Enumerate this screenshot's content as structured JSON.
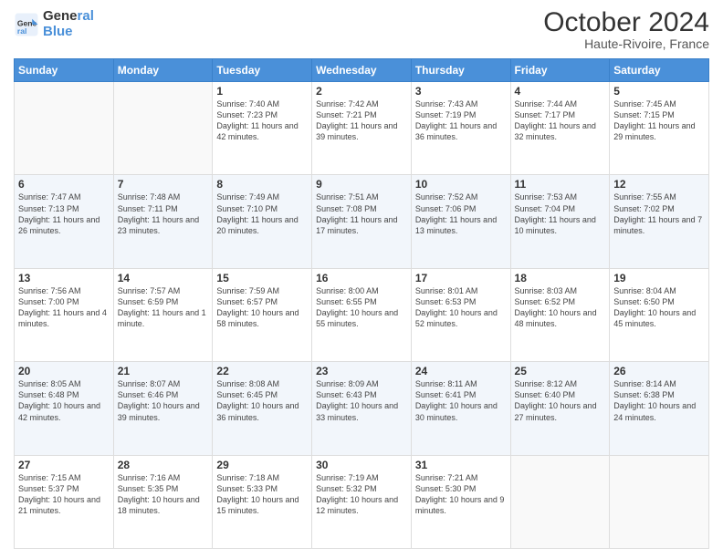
{
  "header": {
    "logo_line1": "General",
    "logo_line2": "Blue",
    "title": "October 2024",
    "subtitle": "Haute-Rivoire, France"
  },
  "weekdays": [
    "Sunday",
    "Monday",
    "Tuesday",
    "Wednesday",
    "Thursday",
    "Friday",
    "Saturday"
  ],
  "weeks": [
    [
      {
        "day": null
      },
      {
        "day": null
      },
      {
        "day": "1",
        "sunrise": "7:40 AM",
        "sunset": "7:23 PM",
        "daylight": "11 hours and 42 minutes."
      },
      {
        "day": "2",
        "sunrise": "7:42 AM",
        "sunset": "7:21 PM",
        "daylight": "11 hours and 39 minutes."
      },
      {
        "day": "3",
        "sunrise": "7:43 AM",
        "sunset": "7:19 PM",
        "daylight": "11 hours and 36 minutes."
      },
      {
        "day": "4",
        "sunrise": "7:44 AM",
        "sunset": "7:17 PM",
        "daylight": "11 hours and 32 minutes."
      },
      {
        "day": "5",
        "sunrise": "7:45 AM",
        "sunset": "7:15 PM",
        "daylight": "11 hours and 29 minutes."
      }
    ],
    [
      {
        "day": "6",
        "sunrise": "7:47 AM",
        "sunset": "7:13 PM",
        "daylight": "11 hours and 26 minutes."
      },
      {
        "day": "7",
        "sunrise": "7:48 AM",
        "sunset": "7:11 PM",
        "daylight": "11 hours and 23 minutes."
      },
      {
        "day": "8",
        "sunrise": "7:49 AM",
        "sunset": "7:10 PM",
        "daylight": "11 hours and 20 minutes."
      },
      {
        "day": "9",
        "sunrise": "7:51 AM",
        "sunset": "7:08 PM",
        "daylight": "11 hours and 17 minutes."
      },
      {
        "day": "10",
        "sunrise": "7:52 AM",
        "sunset": "7:06 PM",
        "daylight": "11 hours and 13 minutes."
      },
      {
        "day": "11",
        "sunrise": "7:53 AM",
        "sunset": "7:04 PM",
        "daylight": "11 hours and 10 minutes."
      },
      {
        "day": "12",
        "sunrise": "7:55 AM",
        "sunset": "7:02 PM",
        "daylight": "11 hours and 7 minutes."
      }
    ],
    [
      {
        "day": "13",
        "sunrise": "7:56 AM",
        "sunset": "7:00 PM",
        "daylight": "11 hours and 4 minutes."
      },
      {
        "day": "14",
        "sunrise": "7:57 AM",
        "sunset": "6:59 PM",
        "daylight": "11 hours and 1 minute."
      },
      {
        "day": "15",
        "sunrise": "7:59 AM",
        "sunset": "6:57 PM",
        "daylight": "10 hours and 58 minutes."
      },
      {
        "day": "16",
        "sunrise": "8:00 AM",
        "sunset": "6:55 PM",
        "daylight": "10 hours and 55 minutes."
      },
      {
        "day": "17",
        "sunrise": "8:01 AM",
        "sunset": "6:53 PM",
        "daylight": "10 hours and 52 minutes."
      },
      {
        "day": "18",
        "sunrise": "8:03 AM",
        "sunset": "6:52 PM",
        "daylight": "10 hours and 48 minutes."
      },
      {
        "day": "19",
        "sunrise": "8:04 AM",
        "sunset": "6:50 PM",
        "daylight": "10 hours and 45 minutes."
      }
    ],
    [
      {
        "day": "20",
        "sunrise": "8:05 AM",
        "sunset": "6:48 PM",
        "daylight": "10 hours and 42 minutes."
      },
      {
        "day": "21",
        "sunrise": "8:07 AM",
        "sunset": "6:46 PM",
        "daylight": "10 hours and 39 minutes."
      },
      {
        "day": "22",
        "sunrise": "8:08 AM",
        "sunset": "6:45 PM",
        "daylight": "10 hours and 36 minutes."
      },
      {
        "day": "23",
        "sunrise": "8:09 AM",
        "sunset": "6:43 PM",
        "daylight": "10 hours and 33 minutes."
      },
      {
        "day": "24",
        "sunrise": "8:11 AM",
        "sunset": "6:41 PM",
        "daylight": "10 hours and 30 minutes."
      },
      {
        "day": "25",
        "sunrise": "8:12 AM",
        "sunset": "6:40 PM",
        "daylight": "10 hours and 27 minutes."
      },
      {
        "day": "26",
        "sunrise": "8:14 AM",
        "sunset": "6:38 PM",
        "daylight": "10 hours and 24 minutes."
      }
    ],
    [
      {
        "day": "27",
        "sunrise": "7:15 AM",
        "sunset": "5:37 PM",
        "daylight": "10 hours and 21 minutes."
      },
      {
        "day": "28",
        "sunrise": "7:16 AM",
        "sunset": "5:35 PM",
        "daylight": "10 hours and 18 minutes."
      },
      {
        "day": "29",
        "sunrise": "7:18 AM",
        "sunset": "5:33 PM",
        "daylight": "10 hours and 15 minutes."
      },
      {
        "day": "30",
        "sunrise": "7:19 AM",
        "sunset": "5:32 PM",
        "daylight": "10 hours and 12 minutes."
      },
      {
        "day": "31",
        "sunrise": "7:21 AM",
        "sunset": "5:30 PM",
        "daylight": "10 hours and 9 minutes."
      },
      {
        "day": null
      },
      {
        "day": null
      }
    ]
  ]
}
